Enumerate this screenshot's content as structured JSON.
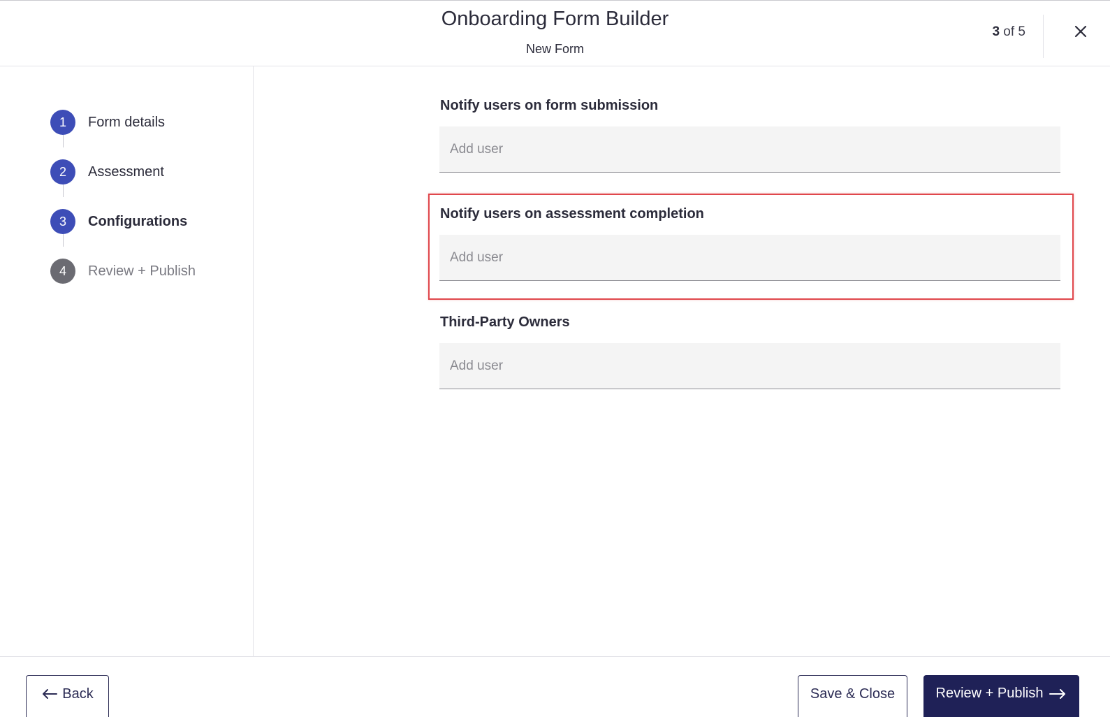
{
  "header": {
    "title": "Onboarding Form Builder",
    "subtitle": "New Form",
    "step_current": "3",
    "step_total_text": " of 5"
  },
  "icons": {
    "close": "close-icon",
    "back": "arrow-left-icon",
    "forward": "arrow-right-icon"
  },
  "sidebar": {
    "steps": [
      {
        "number": "1",
        "label": "Form details",
        "state": "complete"
      },
      {
        "number": "2",
        "label": "Assessment",
        "state": "complete"
      },
      {
        "number": "3",
        "label": "Configurations",
        "state": "current"
      },
      {
        "number": "4",
        "label": "Review + Publish",
        "state": "upcoming"
      }
    ]
  },
  "main": {
    "fields": [
      {
        "label": "Notify users on form submission",
        "placeholder": "Add user",
        "value": ""
      },
      {
        "label": "Notify users on assessment completion",
        "placeholder": "Add user",
        "value": ""
      },
      {
        "label": "Third-Party Owners",
        "placeholder": "Add user",
        "value": ""
      }
    ]
  },
  "footer": {
    "back_label": "Back",
    "save_label": "Save & Close",
    "publish_label": "Review + Publish"
  },
  "colors": {
    "accent": "#3d4db7",
    "primary_button": "#1f2157",
    "highlight": "#e0474c",
    "inactive_step": "#6b6b72"
  }
}
